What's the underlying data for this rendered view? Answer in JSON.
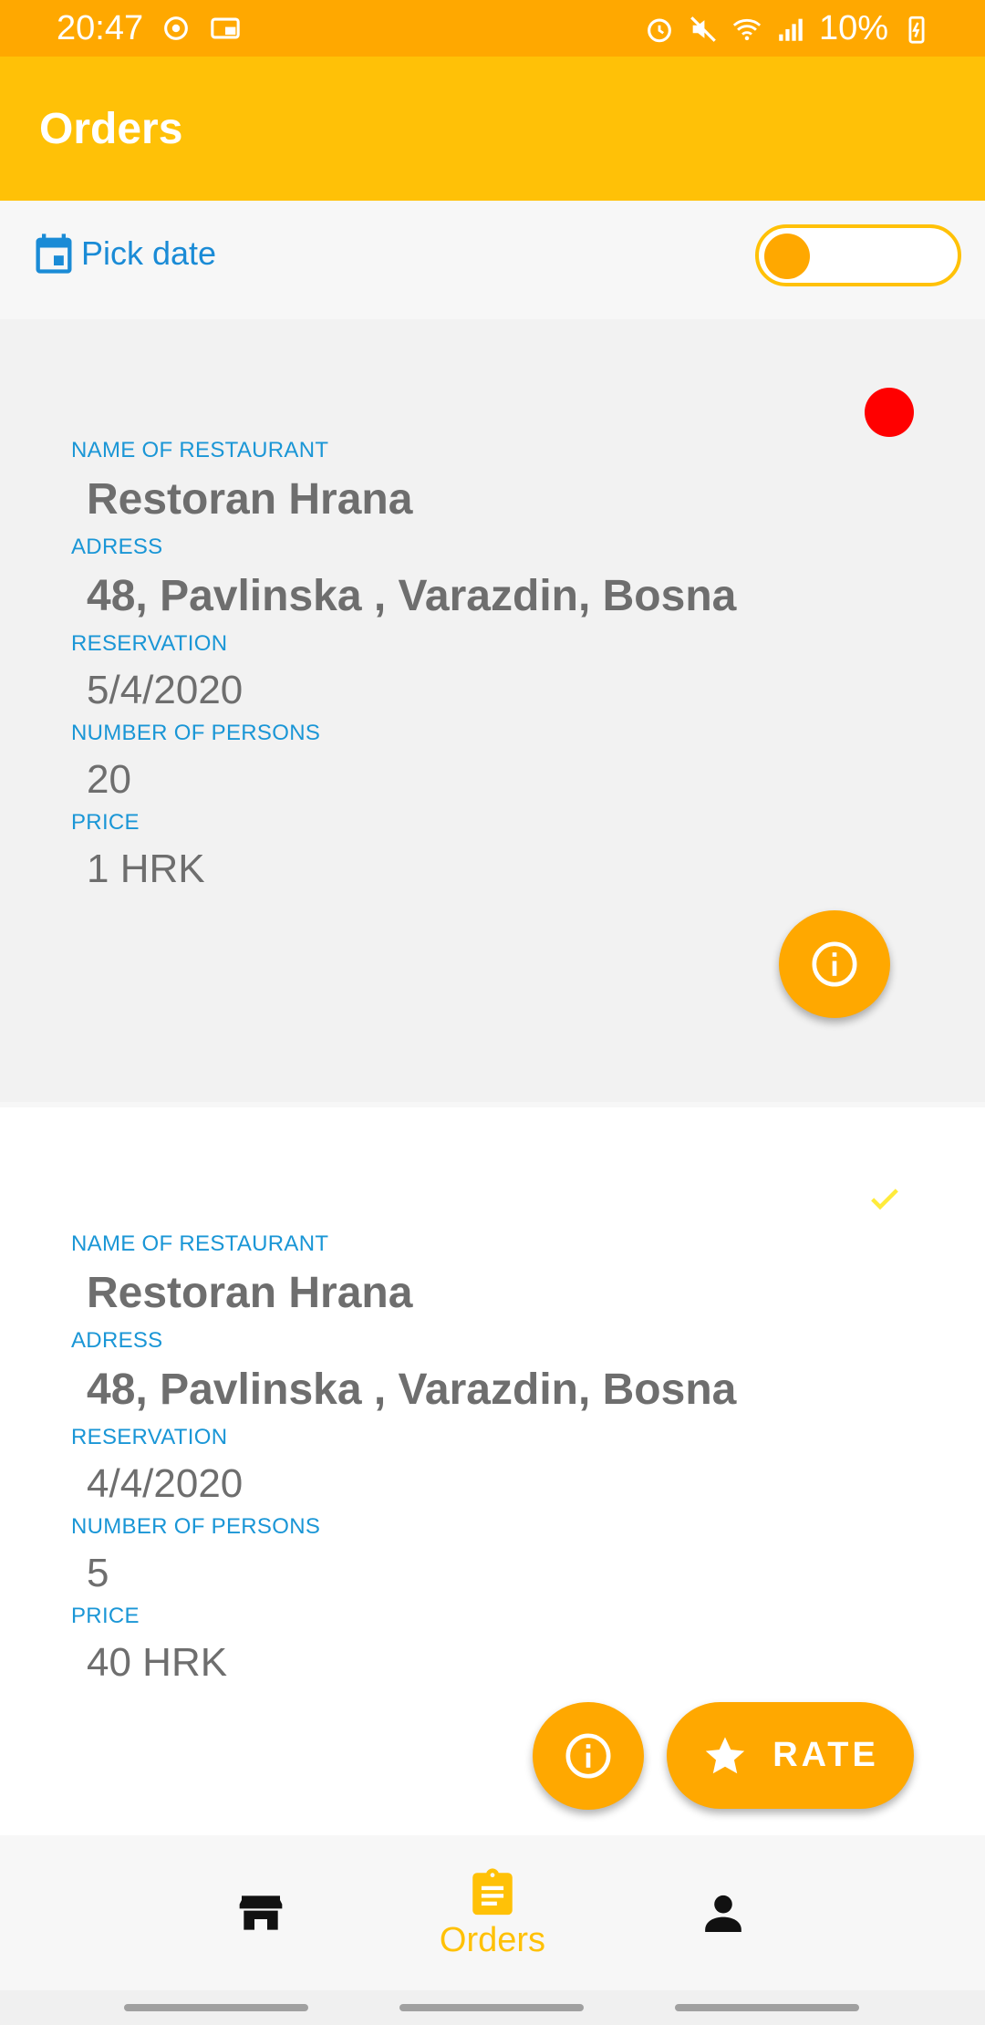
{
  "status_bar": {
    "time": "20:47",
    "battery": "10%",
    "icons_left": [
      "sync-icon",
      "screen-cast-icon"
    ],
    "icons_right": [
      "alarm-icon",
      "mute-icon",
      "wifi-icon",
      "signal-icon",
      "battery-charging-icon"
    ]
  },
  "app_bar": {
    "title": "Orders"
  },
  "filter": {
    "pick_date_label": "Pick date",
    "toggle_on": false
  },
  "orders": [
    {
      "status": "pending",
      "name_label": "NAME OF RESTAURANT",
      "name": "Restoran Hrana",
      "address_label": "ADRESS",
      "address": "48, Pavlinska , Varazdin, Bosna",
      "reservation_label": "RESERVATION",
      "reservation": "5/4/2020",
      "persons_label": "NUMBER OF PERSONS",
      "persons": "20",
      "price_label": "PRICE",
      "price": "1 HRK"
    },
    {
      "status": "completed",
      "name_label": "NAME OF RESTAURANT",
      "name": "Restoran Hrana",
      "address_label": "ADRESS",
      "address": "48, Pavlinska , Varazdin, Bosna",
      "reservation_label": "RESERVATION",
      "reservation": "4/4/2020",
      "persons_label": "NUMBER OF PERSONS",
      "persons": "5",
      "price_label": "PRICE",
      "price": "40 HRK",
      "rate_label": "RATE"
    }
  ],
  "bottom_nav": {
    "items": [
      {
        "icon": "store-icon",
        "label": ""
      },
      {
        "icon": "clipboard-icon",
        "label": "Orders",
        "active": true
      },
      {
        "icon": "person-icon",
        "label": ""
      }
    ]
  },
  "colors": {
    "status_bar": "#FFA800",
    "app_bar": "#FFC107",
    "accent": "#FFA800",
    "label_blue": "#1a96d6",
    "pending_dot": "#ff0000",
    "check_yellow": "#ffeb3b"
  }
}
